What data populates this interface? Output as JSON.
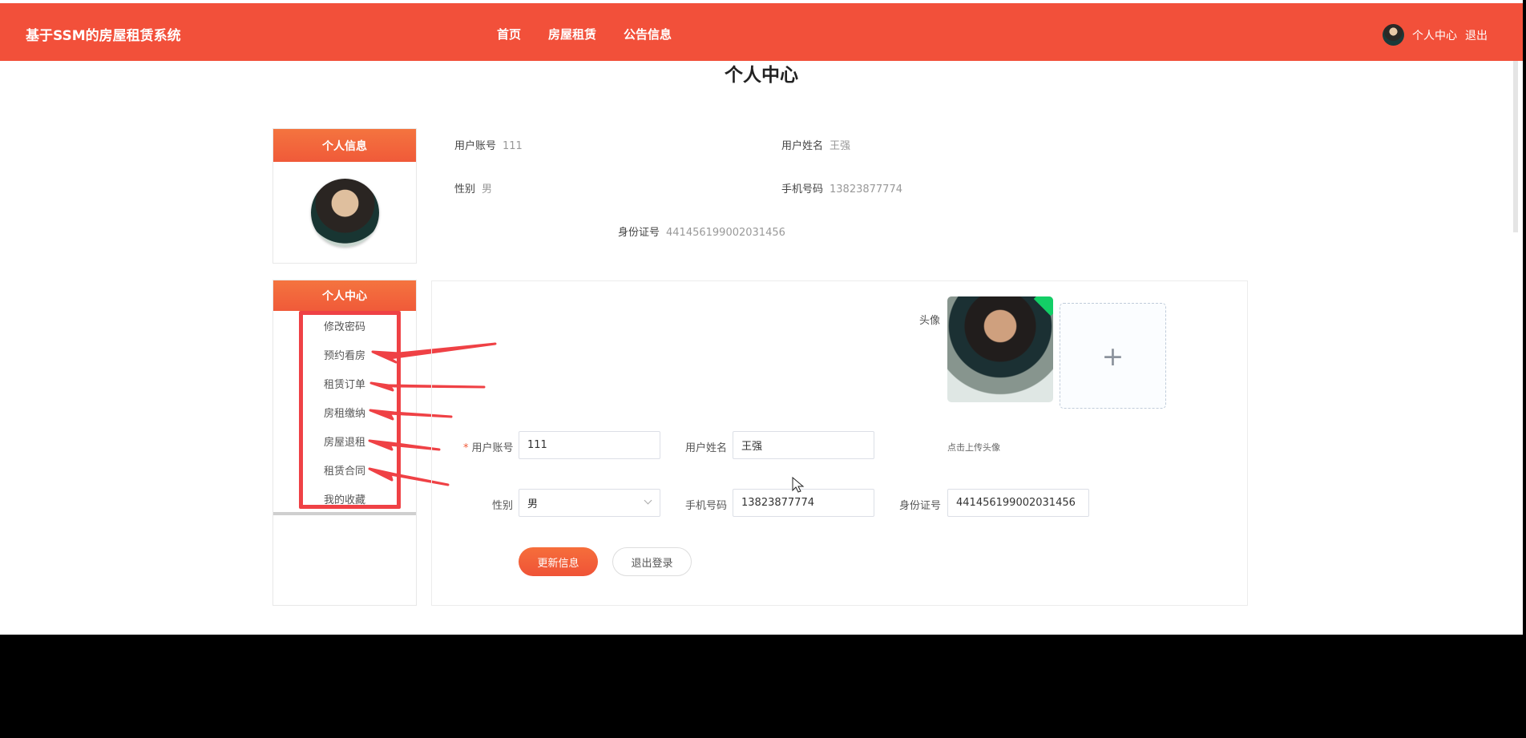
{
  "header": {
    "brand": "基于SSM的房屋租赁系统",
    "nav": [
      {
        "label": "首页"
      },
      {
        "label": "房屋租赁"
      },
      {
        "label": "公告信息"
      }
    ],
    "user_center": "个人中心",
    "logout": "退出"
  },
  "page": {
    "title": "个人中心"
  },
  "profile_card": {
    "title": "个人信息"
  },
  "profile_info": {
    "account_label": "用户账号",
    "account_value": "111",
    "name_label": "用户姓名",
    "name_value": "王强",
    "gender_label": "性别",
    "gender_value": "男",
    "phone_label": "手机号码",
    "phone_value": "13823877774",
    "id_label": "身份证号",
    "id_value": "441456199002031456"
  },
  "side_menu": {
    "title": "个人中心",
    "items": [
      {
        "label": "修改密码"
      },
      {
        "label": "预约看房"
      },
      {
        "label": "租赁订单"
      },
      {
        "label": "房租缴纳"
      },
      {
        "label": "房屋退租"
      },
      {
        "label": "租赁合同"
      },
      {
        "label": "我的收藏"
      }
    ]
  },
  "form": {
    "avatar_label": "头像",
    "upload_hint": "点击上传头像",
    "upload_plus": "+",
    "account_label": "用户账号",
    "account_value": "111",
    "name_label": "用户姓名",
    "name_value": "王强",
    "gender_label": "性别",
    "gender_value": "男",
    "phone_label": "手机号码",
    "phone_value": "13823877774",
    "id_label": "身份证号",
    "id_value": "441456199002031456",
    "update_button": "更新信息",
    "logout_button": "退出登录"
  },
  "colors": {
    "primary": "#f2503a",
    "annotation": "#ef4145",
    "success": "#13ce66"
  }
}
